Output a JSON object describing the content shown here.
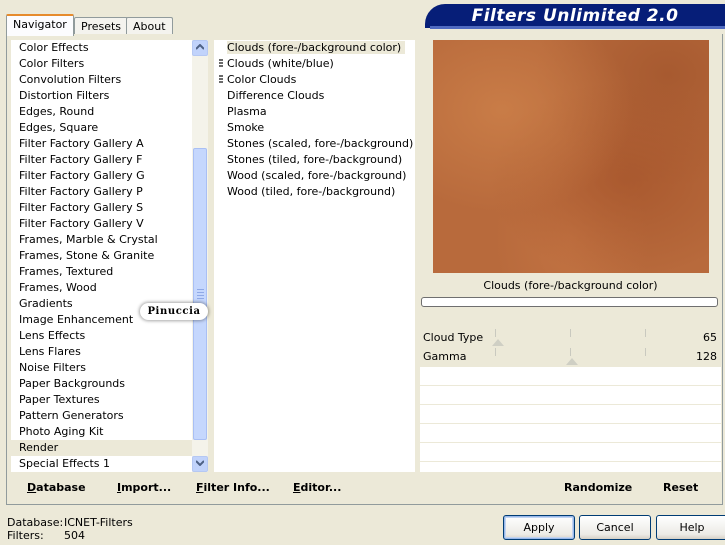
{
  "tabs": [
    {
      "label": "Navigator"
    },
    {
      "label": "Presets"
    },
    {
      "label": "About"
    }
  ],
  "brand": "Filters Unlimited 2.0",
  "categories": {
    "items": [
      "Color Effects",
      "Color Filters",
      "Convolution Filters",
      "Distortion Filters",
      "Edges, Round",
      "Edges, Square",
      "Filter Factory Gallery A",
      "Filter Factory Gallery F",
      "Filter Factory Gallery G",
      "Filter Factory Gallery P",
      "Filter Factory Gallery S",
      "Filter Factory Gallery V",
      "Frames, Marble & Crystal",
      "Frames, Stone & Granite",
      "Frames, Textured",
      "Frames, Wood",
      "Gradients",
      "Image Enhancement",
      "Lens Effects",
      "Lens Flares",
      "Noise Filters",
      "Paper Backgrounds",
      "Paper Textures",
      "Pattern Generators",
      "Photo Aging Kit",
      "Render",
      "Special Effects 1"
    ],
    "selected": "Render"
  },
  "filters": {
    "items": [
      "Clouds (fore-/background color)",
      "Clouds (white/blue)",
      "Color Clouds",
      "Difference Clouds",
      "Plasma",
      "Smoke",
      "Stones (scaled, fore-/background)",
      "Stones (tiled, fore-/background)",
      "Wood (scaled, fore-/background)",
      "Wood (tiled, fore-/background)"
    ],
    "selected": "Clouds (fore-/background color)"
  },
  "preview": {
    "label": "Clouds (fore-/background color)",
    "progress": 0
  },
  "params": [
    {
      "name": "Cloud Type",
      "value": "65"
    },
    {
      "name": "Gamma",
      "value": "128"
    }
  ],
  "toolbar_left": [
    {
      "label": "Database",
      "underline": "D",
      "rest": "atabase"
    },
    {
      "label": "Import...",
      "underline": "I",
      "rest": "mport..."
    },
    {
      "label": "Filter Info...",
      "underline": "F",
      "rest": "ilter Info..."
    },
    {
      "label": "Editor...",
      "underline": "E",
      "rest": "ditor..."
    }
  ],
  "toolbar_right": {
    "randomize": "Randomize",
    "reset": "Reset"
  },
  "status": {
    "database_label": "Database:",
    "database_value": "ICNET-Filters",
    "filters_label": "Filters:",
    "filters_value": "504"
  },
  "buttons": {
    "apply": "Apply",
    "cancel": "Cancel",
    "help": "Help"
  },
  "watermark": "Pinuccia",
  "colors": {
    "brand_bg": "#061e78",
    "tab_accent": "#e68b2c",
    "preview_base": "#b86a3c"
  }
}
